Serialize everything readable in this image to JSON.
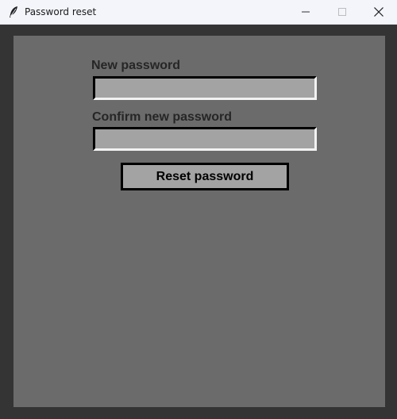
{
  "window": {
    "title": "Password reset",
    "app_icon": "feather-icon",
    "controls": [
      "minimize-icon",
      "maximize-icon",
      "close-icon"
    ]
  },
  "form": {
    "new_password_label": "New password",
    "new_password_value": "",
    "confirm_password_label": "Confirm new password",
    "confirm_password_value": "",
    "reset_button_label": "Reset password"
  },
  "colors": {
    "panel_bg": "#6b6b6b",
    "field_bg": "#a3a3a3",
    "label_text": "#262626",
    "titlebar_bg": "#f3f5fb"
  }
}
